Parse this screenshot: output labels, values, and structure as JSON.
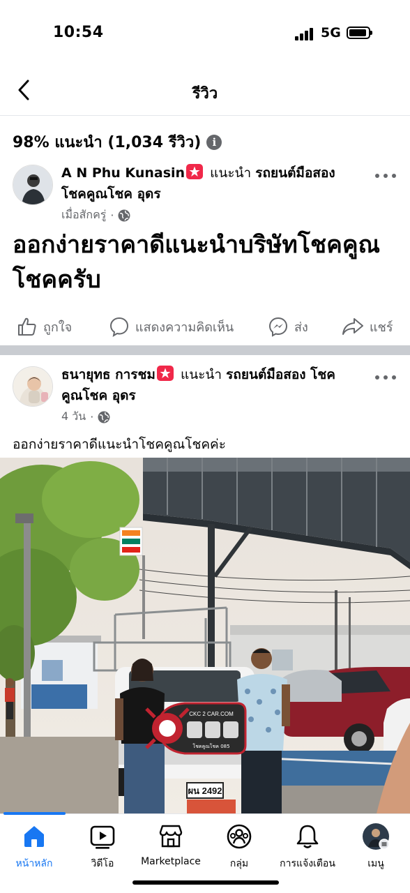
{
  "status_bar": {
    "time": "10:54",
    "network": "5G"
  },
  "header": {
    "title": "รีวิว"
  },
  "summary": {
    "text": "98% แนะนำ (1,034 รีวิว)",
    "info_glyph": "i"
  },
  "reviews": [
    {
      "author": "A N Phu Kunasin",
      "recommend_text": "แนะนำ",
      "page_name_line1": "รถยนต์มือสอง",
      "page_name_line2": "โชคคูณโชค อุดร",
      "time": "เมื่อสักครู่",
      "body": "ออกง่ายราคาดีแนะนำบริษัทโชคคูณโชคครับ"
    },
    {
      "author": "ธนายุทธ การชม",
      "recommend_text": "แนะนำ",
      "page_name_line1": "รถยนต์มือสอง โชค",
      "page_name_line2": "คูณโชค อุดร",
      "time": "4 วัน",
      "body": "ออกง่ายราคาดีแนะนำโชคคูณโชคค่ะ"
    }
  ],
  "actions": {
    "like": "ถูกใจ",
    "comment": "แสดงความคิดเห็น",
    "send": "ส่ง",
    "share": "แชร์"
  },
  "photo": {
    "store_sign": "7-Eleven",
    "key_sign": "CKC 2 CAR.COM",
    "key_subtext": "โชคคูณโชค 085",
    "plate_text": "ผน 2492"
  },
  "bottom_nav": [
    {
      "label": "หน้าหลัก",
      "icon": "home-icon",
      "active": true
    },
    {
      "label": "วิดีโอ",
      "icon": "video-icon",
      "active": false
    },
    {
      "label": "Marketplace",
      "icon": "marketplace-icon",
      "active": false
    },
    {
      "label": "กลุ่ม",
      "icon": "groups-icon",
      "active": false
    },
    {
      "label": "การแจ้งเตือน",
      "icon": "bell-icon",
      "active": false
    },
    {
      "label": "เมนู",
      "icon": "menu-avatar-icon",
      "active": false
    }
  ],
  "colors": {
    "accent": "#1877f2",
    "badge": "#f02849",
    "secondary_text": "#65676b"
  }
}
